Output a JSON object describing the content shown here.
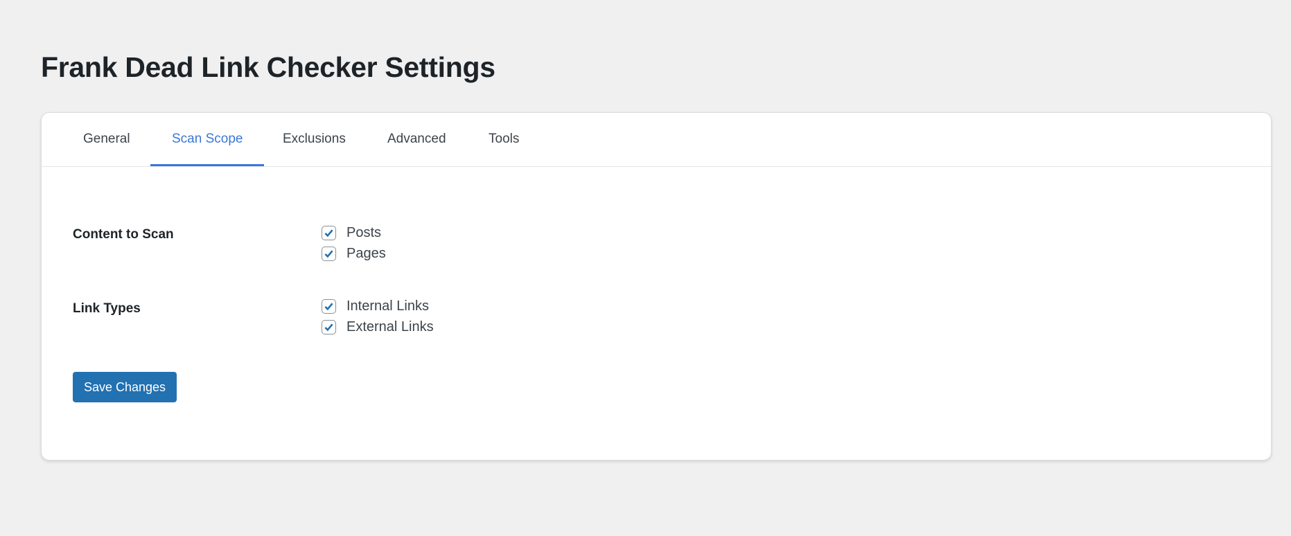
{
  "page": {
    "title": "Frank Dead Link Checker Settings"
  },
  "tabs": [
    {
      "label": "General",
      "active": false
    },
    {
      "label": "Scan Scope",
      "active": true
    },
    {
      "label": "Exclusions",
      "active": false
    },
    {
      "label": "Advanced",
      "active": false
    },
    {
      "label": "Tools",
      "active": false
    }
  ],
  "sections": [
    {
      "label": "Content to Scan",
      "options": [
        {
          "label": "Posts",
          "checked": true
        },
        {
          "label": "Pages",
          "checked": true
        }
      ]
    },
    {
      "label": "Link Types",
      "options": [
        {
          "label": "Internal Links",
          "checked": true
        },
        {
          "label": "External Links",
          "checked": true
        }
      ]
    }
  ],
  "actions": {
    "save_label": "Save Changes"
  },
  "colors": {
    "accent": "#3a78d6",
    "button": "#2271b1",
    "background": "#f0f0f1"
  }
}
